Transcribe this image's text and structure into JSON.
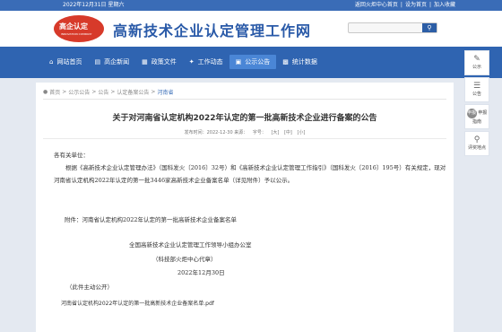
{
  "topbar": {
    "date": "2022年12月31日 星期六",
    "links": [
      "返回火炬中心首页",
      "|",
      "设为首页",
      "|",
      "加入收藏"
    ]
  },
  "header": {
    "logo_text": "高企认定",
    "logo_sub": "INNOVATION COMPANY",
    "site_title": "高新技术企业认定管理工作网",
    "search_icon": "search-icon"
  },
  "nav": [
    {
      "label": "网站首页",
      "icon": "home-icon",
      "active": false
    },
    {
      "label": "高企新闻",
      "icon": "news-icon",
      "active": false
    },
    {
      "label": "政策文件",
      "icon": "document-icon",
      "active": false
    },
    {
      "label": "工作动态",
      "icon": "pin-icon",
      "active": true
    },
    {
      "label": "公示公告",
      "icon": "monitor-icon",
      "active": false
    },
    {
      "label": "统计数据",
      "icon": "chart-icon",
      "active": false
    }
  ],
  "breadcrumb": {
    "home": "首页",
    "items": [
      "公示公告",
      "公告",
      "认定备案公告"
    ],
    "current": "河南省"
  },
  "article": {
    "title": "关于对河南省认定机构2022年认定的第一批高新技术企业进行备案的公告",
    "date_label": "发布时间：2022-12-30 来源：",
    "size_label": "字号：",
    "size_options": [
      "[大]",
      "[中]",
      "[小]"
    ],
    "greeting": "各有关单位：",
    "body": "根据《高新技术企业认定管理办法》（国科发火〔2016〕32号）和《高新技术企业认定管理工作指引》（国科发火〔2016〕195号）有关规定，现对河南省认定机构2022年认定的第一批3446家高新技术企业备案名单（详见附件）予以公示。",
    "attachment_line": "附件：河南省认定机构2022年认定的第一批高新技术企业备案名单",
    "sign1": "全国高新技术企业认定管理工作领导小组办公室",
    "sign2": "（科技部火炬中心代章）",
    "sign3": "2022年12月30日",
    "public_note": "（此件主动公开）",
    "pdf_link": "河南省认定机构2022年认定的第一批高新技术企业备案名单.pdf"
  },
  "sidebar": [
    {
      "label": "公示",
      "icon": "notice-icon"
    },
    {
      "label": "公告",
      "icon": "announcement-icon"
    },
    {
      "label": "申报指南",
      "icon": "guide-icon",
      "circle": "申报"
    },
    {
      "label": "评奖地点",
      "icon": "location-icon"
    }
  ]
}
